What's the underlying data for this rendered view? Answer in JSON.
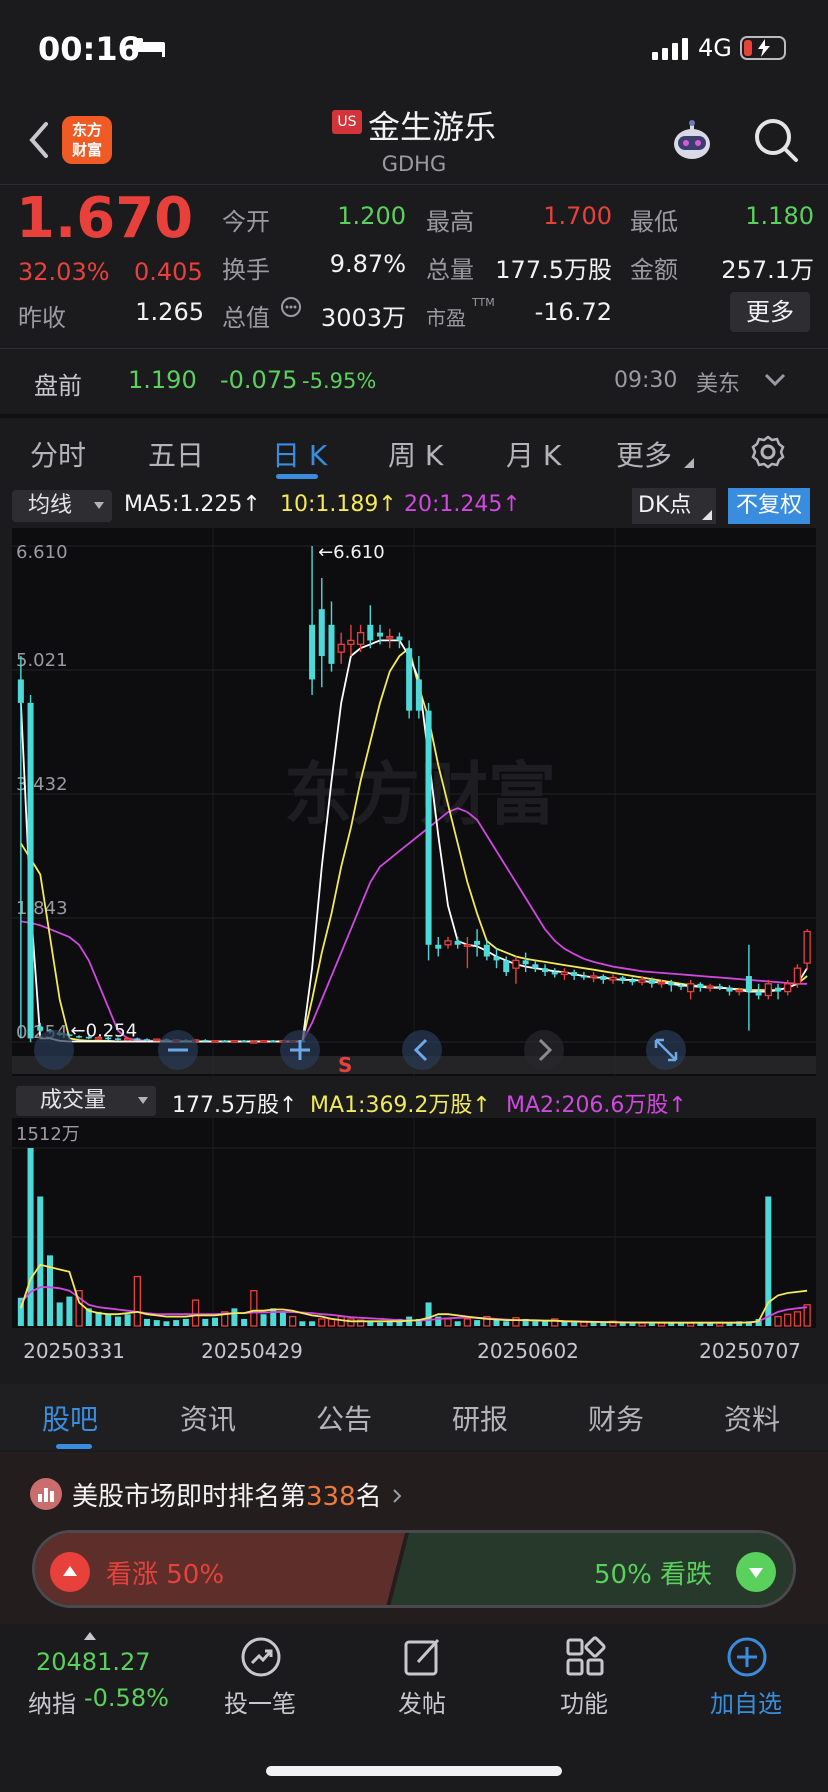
{
  "status_bar": {
    "time": "00:16",
    "network": "4G"
  },
  "header": {
    "market_badge": "US",
    "stock_name": "金生游乐",
    "stock_code": "GDHG",
    "logo_text_line1": "东方",
    "logo_text_line2": "财富"
  },
  "quote": {
    "price": "1.670",
    "change_pct": "32.03%",
    "change": "0.405",
    "open_label": "今开",
    "open": "1.200",
    "high_label": "最高",
    "high": "1.700",
    "low_label": "最低",
    "low": "1.180",
    "turnover_label": "换手",
    "turnover": "9.87%",
    "volume_label": "总量",
    "volume": "177.5万股",
    "amount_label": "金额",
    "amount": "257.1万",
    "prev_close_label": "昨收",
    "prev_close": "1.265",
    "mktcap_label": "总值",
    "mktcap": "3003万",
    "pe_label": "市盈",
    "pe_sup": "TTM",
    "pe": "-16.72",
    "more_label": "更多"
  },
  "premarket": {
    "label": "盘前",
    "price": "1.190",
    "change": "-0.075",
    "change_pct": "-5.95%",
    "time": "09:30",
    "zone": "美东"
  },
  "period_tabs": [
    "分时",
    "五日",
    "日 K",
    "周 K",
    "月 K",
    "更多"
  ],
  "indicators": {
    "ma_select": "均线",
    "ma5": "MA5:1.225↑",
    "ma10": "10:1.189↑",
    "ma20": "20:1.245↑",
    "dk_label": "DK点",
    "fq_label": "不复权"
  },
  "volume_indicators": {
    "select": "成交量",
    "vol": "177.5万股↑",
    "ma1": "MA1:369.2万股↑",
    "ma2": "MA2:206.6万股↑"
  },
  "colors": {
    "up": "#e8413c",
    "down": "#5bd15d",
    "candle_down": "#4fd8d8",
    "ma5": "#ffffff",
    "ma10": "#f3ea58",
    "ma20": "#d048e0",
    "accent": "#3a8dde"
  },
  "chart_data": [
    {
      "type": "candlestick",
      "y_ticks": [
        "6.610",
        "5.021",
        "3.432",
        "1.843",
        "0.254"
      ],
      "ylim": [
        0.254,
        6.61
      ],
      "annotations": [
        "6.610",
        "0.254"
      ],
      "watermark": "东方财富",
      "candles": [
        {
          "o": 4.9,
          "c": 4.6,
          "h": 5.2,
          "l": 0.3
        },
        {
          "o": 4.6,
          "c": 0.3,
          "h": 4.7,
          "l": 0.25
        },
        {
          "o": 0.45,
          "c": 0.4,
          "h": 0.5,
          "l": 0.38
        },
        {
          "o": 0.4,
          "c": 0.38,
          "h": 0.42,
          "l": 0.36
        },
        {
          "o": 0.37,
          "c": 0.35,
          "h": 0.39,
          "l": 0.33
        },
        {
          "o": 0.35,
          "c": 0.33,
          "h": 0.36,
          "l": 0.31
        },
        {
          "o": 0.33,
          "c": 0.32,
          "h": 0.34,
          "l": 0.3
        },
        {
          "o": 0.32,
          "c": 0.3,
          "h": 0.33,
          "l": 0.29
        },
        {
          "o": 0.3,
          "c": 0.31,
          "h": 0.33,
          "l": 0.28
        },
        {
          "o": 0.31,
          "c": 0.3,
          "h": 0.32,
          "l": 0.28
        },
        {
          "o": 0.3,
          "c": 0.29,
          "h": 0.31,
          "l": 0.27
        },
        {
          "o": 0.29,
          "c": 0.3,
          "h": 0.32,
          "l": 0.27
        },
        {
          "o": 0.3,
          "c": 0.29,
          "h": 0.31,
          "l": 0.27
        },
        {
          "o": 0.29,
          "c": 0.28,
          "h": 0.3,
          "l": 0.26
        },
        {
          "o": 0.28,
          "c": 0.29,
          "h": 0.3,
          "l": 0.26
        },
        {
          "o": 0.29,
          "c": 0.28,
          "h": 0.3,
          "l": 0.26
        },
        {
          "o": 0.28,
          "c": 0.28,
          "h": 0.29,
          "l": 0.26
        },
        {
          "o": 0.28,
          "c": 0.27,
          "h": 0.29,
          "l": 0.26
        },
        {
          "o": 0.27,
          "c": 0.28,
          "h": 0.29,
          "l": 0.26
        },
        {
          "o": 0.28,
          "c": 0.27,
          "h": 0.29,
          "l": 0.26
        },
        {
          "o": 0.27,
          "c": 0.27,
          "h": 0.28,
          "l": 0.26
        },
        {
          "o": 0.27,
          "c": 0.26,
          "h": 0.28,
          "l": 0.25
        },
        {
          "o": 0.26,
          "c": 0.27,
          "h": 0.28,
          "l": 0.25
        },
        {
          "o": 0.27,
          "c": 0.26,
          "h": 0.28,
          "l": 0.25
        },
        {
          "o": 0.26,
          "c": 0.26,
          "h": 0.27,
          "l": 0.25
        },
        {
          "o": 0.26,
          "c": 0.27,
          "h": 0.28,
          "l": 0.25
        },
        {
          "o": 0.27,
          "c": 0.26,
          "h": 0.28,
          "l": 0.25
        },
        {
          "o": 0.26,
          "c": 0.27,
          "h": 0.28,
          "l": 0.25
        },
        {
          "o": 0.27,
          "c": 0.27,
          "h": 0.28,
          "l": 0.26
        },
        {
          "o": 0.27,
          "c": 0.26,
          "h": 0.28,
          "l": 0.25
        },
        {
          "o": 5.6,
          "c": 4.9,
          "h": 6.61,
          "l": 4.7
        },
        {
          "o": 5.8,
          "c": 5.2,
          "h": 6.2,
          "l": 4.8
        },
        {
          "o": 5.6,
          "c": 5.1,
          "h": 5.9,
          "l": 5.0
        },
        {
          "o": 5.25,
          "c": 5.35,
          "h": 5.5,
          "l": 5.1
        },
        {
          "o": 5.35,
          "c": 5.4,
          "h": 5.6,
          "l": 5.2
        },
        {
          "o": 5.35,
          "c": 5.5,
          "h": 5.6,
          "l": 5.25
        },
        {
          "o": 5.6,
          "c": 5.4,
          "h": 5.85,
          "l": 5.3
        },
        {
          "o": 5.5,
          "c": 5.45,
          "h": 5.6,
          "l": 5.35
        },
        {
          "o": 5.45,
          "c": 5.45,
          "h": 5.55,
          "l": 5.3
        },
        {
          "o": 5.45,
          "c": 5.4,
          "h": 5.5,
          "l": 5.3
        },
        {
          "o": 5.3,
          "c": 4.5,
          "h": 5.4,
          "l": 4.4
        },
        {
          "o": 4.9,
          "c": 4.5,
          "h": 5.2,
          "l": 4.4
        },
        {
          "o": 4.5,
          "c": 1.5,
          "h": 4.6,
          "l": 1.3
        },
        {
          "o": 1.5,
          "c": 1.45,
          "h": 1.6,
          "l": 1.35
        },
        {
          "o": 1.5,
          "c": 1.55,
          "h": 1.6,
          "l": 1.45
        },
        {
          "o": 1.55,
          "c": 1.5,
          "h": 1.6,
          "l": 1.45
        },
        {
          "o": 1.5,
          "c": 1.5,
          "h": 1.6,
          "l": 1.2
        },
        {
          "o": 1.55,
          "c": 1.5,
          "h": 1.7,
          "l": 1.35
        },
        {
          "o": 1.5,
          "c": 1.35,
          "h": 1.55,
          "l": 1.3
        },
        {
          "o": 1.35,
          "c": 1.3,
          "h": 1.45,
          "l": 1.2
        },
        {
          "o": 1.3,
          "c": 1.15,
          "h": 1.35,
          "l": 1.1
        },
        {
          "o": 1.2,
          "c": 1.3,
          "h": 1.35,
          "l": 1.0
        },
        {
          "o": 1.3,
          "c": 1.25,
          "h": 1.4,
          "l": 1.15
        },
        {
          "o": 1.25,
          "c": 1.2,
          "h": 1.3,
          "l": 1.15
        },
        {
          "o": 1.2,
          "c": 1.15,
          "h": 1.25,
          "l": 1.1
        },
        {
          "o": 1.15,
          "c": 1.12,
          "h": 1.2,
          "l": 1.08
        },
        {
          "o": 1.12,
          "c": 1.15,
          "h": 1.2,
          "l": 1.05
        },
        {
          "o": 1.15,
          "c": 1.1,
          "h": 1.18,
          "l": 1.05
        },
        {
          "o": 1.1,
          "c": 1.08,
          "h": 1.15,
          "l": 1.05
        },
        {
          "o": 1.08,
          "c": 1.1,
          "h": 1.15,
          "l": 1.02
        },
        {
          "o": 1.1,
          "c": 1.05,
          "h": 1.12,
          "l": 1.0
        },
        {
          "o": 1.05,
          "c": 1.08,
          "h": 1.12,
          "l": 1.0
        },
        {
          "o": 1.08,
          "c": 1.05,
          "h": 1.1,
          "l": 1.0
        },
        {
          "o": 1.05,
          "c": 1.02,
          "h": 1.08,
          "l": 0.98
        },
        {
          "o": 1.02,
          "c": 1.05,
          "h": 1.1,
          "l": 0.98
        },
        {
          "o": 1.05,
          "c": 1.0,
          "h": 1.08,
          "l": 0.95
        },
        {
          "o": 1.0,
          "c": 1.02,
          "h": 1.05,
          "l": 0.95
        },
        {
          "o": 1.02,
          "c": 0.98,
          "h": 1.05,
          "l": 0.9
        },
        {
          "o": 0.98,
          "c": 0.96,
          "h": 1.0,
          "l": 0.92
        },
        {
          "o": 0.9,
          "c": 1.0,
          "h": 1.05,
          "l": 0.8
        },
        {
          "o": 1.0,
          "c": 0.95,
          "h": 1.02,
          "l": 0.9
        },
        {
          "o": 0.95,
          "c": 0.97,
          "h": 1.0,
          "l": 0.9
        },
        {
          "o": 0.97,
          "c": 0.95,
          "h": 1.0,
          "l": 0.92
        },
        {
          "o": 0.95,
          "c": 0.9,
          "h": 0.98,
          "l": 0.85
        },
        {
          "o": 0.9,
          "c": 0.92,
          "h": 0.95,
          "l": 0.85
        },
        {
          "o": 1.1,
          "c": 0.9,
          "h": 1.5,
          "l": 0.4
        },
        {
          "o": 0.9,
          "c": 0.85,
          "h": 1.0,
          "l": 0.8
        },
        {
          "o": 0.85,
          "c": 1.0,
          "h": 1.05,
          "l": 0.8
        },
        {
          "o": 0.95,
          "c": 0.9,
          "h": 1.0,
          "l": 0.8
        },
        {
          "o": 0.9,
          "c": 1.0,
          "h": 1.05,
          "l": 0.85
        },
        {
          "o": 1.0,
          "c": 1.2,
          "h": 1.25,
          "l": 0.95
        },
        {
          "o": 1.265,
          "c": 1.67,
          "h": 1.7,
          "l": 1.18
        }
      ],
      "ma5": [
        4.6,
        2.0,
        0.3,
        0.3,
        0.27,
        0.26,
        0.26,
        0.26,
        0.26,
        0.26,
        0.26,
        0.26,
        0.26,
        0.26,
        0.26,
        0.26,
        0.26,
        0.26,
        0.26,
        0.26,
        0.26,
        0.26,
        0.26,
        0.26,
        0.26,
        0.26,
        0.26,
        0.26,
        0.26,
        0.26,
        1.2,
        2.5,
        3.6,
        4.6,
        5.2,
        5.3,
        5.35,
        5.4,
        5.4,
        5.4,
        5.2,
        4.9,
        3.9,
        2.9,
        2.0,
        1.55,
        1.5,
        1.48,
        1.42,
        1.35,
        1.3,
        1.25,
        1.22,
        1.2,
        1.18,
        1.16,
        1.15,
        1.12,
        1.1,
        1.08,
        1.08,
        1.06,
        1.05,
        1.05,
        1.04,
        1.02,
        1.02,
        1.0,
        0.98,
        0.97,
        0.96,
        0.95,
        0.95,
        0.94,
        0.92,
        0.9,
        0.9,
        0.9,
        0.92,
        0.95,
        1.0,
        1.2
      ],
      "ma10": [
        2.8,
        2.6,
        2.4,
        1.6,
        0.8,
        0.3,
        0.28,
        0.27,
        0.27,
        0.27,
        0.26,
        0.26,
        0.26,
        0.26,
        0.26,
        0.26,
        0.26,
        0.26,
        0.26,
        0.26,
        0.26,
        0.26,
        0.26,
        0.26,
        0.26,
        0.26,
        0.26,
        0.26,
        0.26,
        0.26,
        0.8,
        1.4,
        1.9,
        2.5,
        3.0,
        3.6,
        4.1,
        4.6,
        5.0,
        5.2,
        5.3,
        4.8,
        4.4,
        3.8,
        3.3,
        2.8,
        2.3,
        1.9,
        1.55,
        1.45,
        1.4,
        1.35,
        1.32,
        1.3,
        1.28,
        1.26,
        1.24,
        1.22,
        1.2,
        1.18,
        1.16,
        1.14,
        1.12,
        1.1,
        1.08,
        1.06,
        1.04,
        1.02,
        1.0,
        0.98,
        0.97,
        0.96,
        0.95,
        0.94,
        0.93,
        0.92,
        0.92,
        0.92,
        0.92,
        0.95,
        1.0,
        1.1
      ],
      "ma20": [
        1.8,
        1.78,
        1.75,
        1.7,
        1.65,
        1.6,
        1.5,
        1.3,
        1.0,
        0.7,
        0.4,
        0.3,
        0.28,
        0.27,
        0.27,
        0.27,
        0.26,
        0.26,
        0.26,
        0.26,
        0.26,
        0.26,
        0.26,
        0.26,
        0.26,
        0.26,
        0.26,
        0.26,
        0.26,
        0.26,
        0.5,
        0.8,
        1.1,
        1.4,
        1.7,
        2.0,
        2.3,
        2.5,
        2.6,
        2.7,
        2.8,
        2.9,
        3.0,
        3.1,
        3.2,
        3.25,
        3.2,
        3.1,
        2.9,
        2.7,
        2.5,
        2.3,
        2.1,
        1.9,
        1.7,
        1.55,
        1.45,
        1.38,
        1.32,
        1.28,
        1.25,
        1.22,
        1.2,
        1.18,
        1.16,
        1.15,
        1.14,
        1.13,
        1.12,
        1.11,
        1.1,
        1.09,
        1.08,
        1.07,
        1.06,
        1.05,
        1.04,
        1.03,
        1.02,
        1.01,
        1.0,
        1.0
      ]
    },
    {
      "type": "bar",
      "y_max_label": "1512万",
      "ylim": [
        0,
        1512
      ],
      "x_ticks": [
        "20250331",
        "20250429",
        "20250602",
        "20250707"
      ],
      "volumes": [
        240,
        1512,
        1100,
        600,
        200,
        250,
        300,
        150,
        120,
        100,
        80,
        100,
        420,
        60,
        50,
        40,
        50,
        60,
        220,
        60,
        70,
        120,
        150,
        60,
        300,
        100,
        150,
        120,
        80,
        40,
        40,
        60,
        60,
        80,
        60,
        50,
        40,
        30,
        40,
        60,
        80,
        60,
        200,
        80,
        60,
        40,
        60,
        50,
        80,
        60,
        40,
        70,
        60,
        40,
        50,
        60,
        40,
        30,
        40,
        30,
        30,
        40,
        30,
        30,
        25,
        30,
        30,
        25,
        30,
        25,
        30,
        30,
        25,
        30,
        40,
        40,
        60,
        1100,
        80,
        100,
        120,
        180
      ],
      "up": [
        0,
        0,
        0,
        0,
        0,
        0,
        1,
        0,
        0,
        0,
        0,
        0,
        1,
        0,
        0,
        0,
        0,
        0,
        1,
        0,
        0,
        1,
        0,
        0,
        1,
        0,
        0,
        0,
        1,
        0,
        0,
        1,
        1,
        1,
        1,
        1,
        0,
        0,
        0,
        0,
        0,
        0,
        0,
        0,
        1,
        0,
        1,
        0,
        1,
        0,
        0,
        1,
        0,
        0,
        0,
        1,
        0,
        0,
        1,
        0,
        0,
        1,
        0,
        0,
        1,
        0,
        1,
        0,
        0,
        1,
        0,
        0,
        1,
        0,
        0,
        0,
        0,
        0,
        1,
        1,
        1,
        1
      ],
      "ma1": [
        150,
        400,
        520,
        500,
        480,
        460,
        200,
        130,
        110,
        100,
        100,
        110,
        120,
        100,
        90,
        80,
        80,
        80,
        90,
        90,
        90,
        100,
        110,
        110,
        130,
        130,
        140,
        140,
        130,
        110,
        90,
        80,
        60,
        50,
        40,
        40,
        40,
        40,
        40,
        40,
        45,
        50,
        70,
        100,
        100,
        90,
        80,
        70,
        60,
        55,
        50,
        50,
        50,
        48,
        45,
        45,
        40,
        38,
        35,
        35,
        33,
        32,
        30,
        30,
        30,
        30,
        28,
        28,
        28,
        28,
        28,
        28,
        28,
        28,
        28,
        30,
        40,
        200,
        260,
        280,
        290,
        300
      ],
      "ma2": [
        200,
        290,
        330,
        330,
        320,
        300,
        240,
        180,
        160,
        150,
        140,
        130,
        120,
        110,
        100,
        100,
        100,
        100,
        100,
        100,
        100,
        105,
        110,
        110,
        115,
        115,
        118,
        120,
        118,
        115,
        110,
        100,
        95,
        85,
        75,
        70,
        65,
        60,
        55,
        50,
        48,
        46,
        50,
        60,
        65,
        70,
        72,
        70,
        65,
        60,
        55,
        50,
        48,
        46,
        45,
        44,
        42,
        40,
        38,
        36,
        34,
        33,
        32,
        31,
        30,
        30,
        30,
        30,
        29,
        29,
        29,
        29,
        29,
        28,
        28,
        30,
        40,
        80,
        120,
        140,
        150,
        160
      ]
    }
  ],
  "bottom_tabs": [
    "股吧",
    "资讯",
    "公告",
    "研报",
    "财务",
    "资料"
  ],
  "ranking": {
    "prefix": "美股市场即时排名第",
    "rank": "338",
    "suffix": "名"
  },
  "vote": {
    "up": "看涨 50%",
    "down": "50% 看跌"
  },
  "nav": {
    "index_value": "20481.27",
    "index_name": "纳指",
    "index_pct": "-0.58%",
    "trade": "投一笔",
    "post": "发帖",
    "func": "功能",
    "watch": "加自选"
  }
}
